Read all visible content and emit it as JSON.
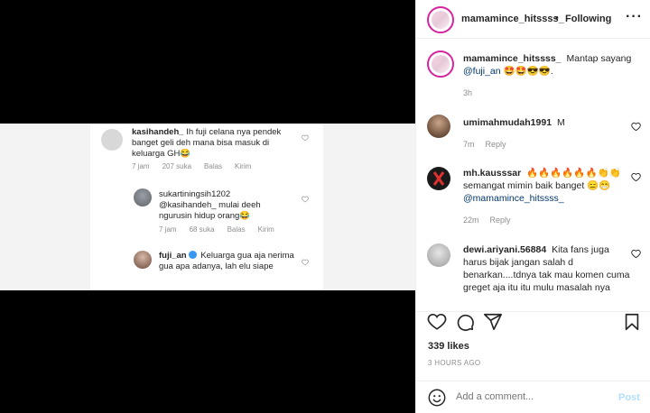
{
  "media": {
    "comments": [
      {
        "user": "kasihandeh_",
        "text": "Ih fuji celana nya pendek banget geli deh mana bisa masuk di keluarga GH😂",
        "time": "7 jam",
        "likes": "207 suka",
        "reply": "Balas",
        "send": "Kirim"
      },
      {
        "user": "sukartiningsih1202",
        "mention": "@kasihandeh_",
        "text": "mulai deeh ngurusin hidup orang😂",
        "time": "7 jam",
        "likes": "68 suka",
        "reply": "Balas",
        "send": "Kirim"
      },
      {
        "user": "fuji_an",
        "text": "Keluarga gua aja nerima gua apa adanya, lah elu siape"
      }
    ]
  },
  "header": {
    "username": "mamamince_hitssss_",
    "separator": "•",
    "follow_label": "Following",
    "more": "···"
  },
  "caption": {
    "username": "mamamince_hitssss_",
    "text": "Mantap sayang",
    "mention": "@fuji_an",
    "emojis": "🤩🤩😎😎.",
    "time": "3h"
  },
  "comments": [
    {
      "user": "umimahmudah1991",
      "text": "M",
      "time": "7m",
      "reply": "Reply"
    },
    {
      "user": "mh.kausssar",
      "text": "🔥🔥🔥🔥🔥🔥👏👏 semangat mimin baik banget 😑😁",
      "mention": "@mamamince_hitssss_",
      "time": "22m",
      "reply": "Reply"
    },
    {
      "user": "dewi.ariyani.56884",
      "text": "Kita fans juga harus bijak jangan salah d benarkan....tdnya tak mau komen cuma greget aja itu itu mulu masalah nya"
    }
  ],
  "likes": "339 likes",
  "timestamp": "3 HOURS AGO",
  "add_comment": {
    "placeholder": "Add a comment...",
    "post_label": "Post"
  },
  "colors": {
    "brand_story_ring": "#d6249f",
    "link": "#00376b",
    "post_disabled": "#b2dffc",
    "muted": "#8e8e8e"
  }
}
